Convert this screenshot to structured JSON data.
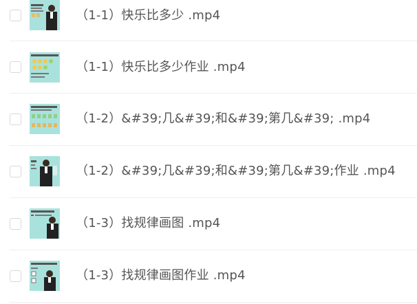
{
  "files": [
    {
      "name": "（1-1）快乐比多少 .mp4",
      "thumbnail": "lecture-video-thumbnail"
    },
    {
      "name": "（1-1）快乐比多少作业 .mp4",
      "thumbnail": "exercise-video-thumbnail"
    },
    {
      "name": "（1-2）&#39;几&#39;和&#39;第几&#39; .mp4",
      "thumbnail": "exercise-video-thumbnail"
    },
    {
      "name": "（1-2）&#39;几&#39;和&#39;第几&#39;作业 .mp4",
      "thumbnail": "lecture-video-thumbnail"
    },
    {
      "name": "（1-3）找规律画图 .mp4",
      "thumbnail": "lecture-video-thumbnail"
    },
    {
      "name": "（1-3）找规律画图作业 .mp4",
      "thumbnail": "lecture-video-thumbnail"
    }
  ],
  "colors": {
    "thumbnail_background": "#a9e2dc",
    "file_name_text": "#555555",
    "divider": "#eeeeee",
    "checkbox_border": "#d9d9d9"
  }
}
